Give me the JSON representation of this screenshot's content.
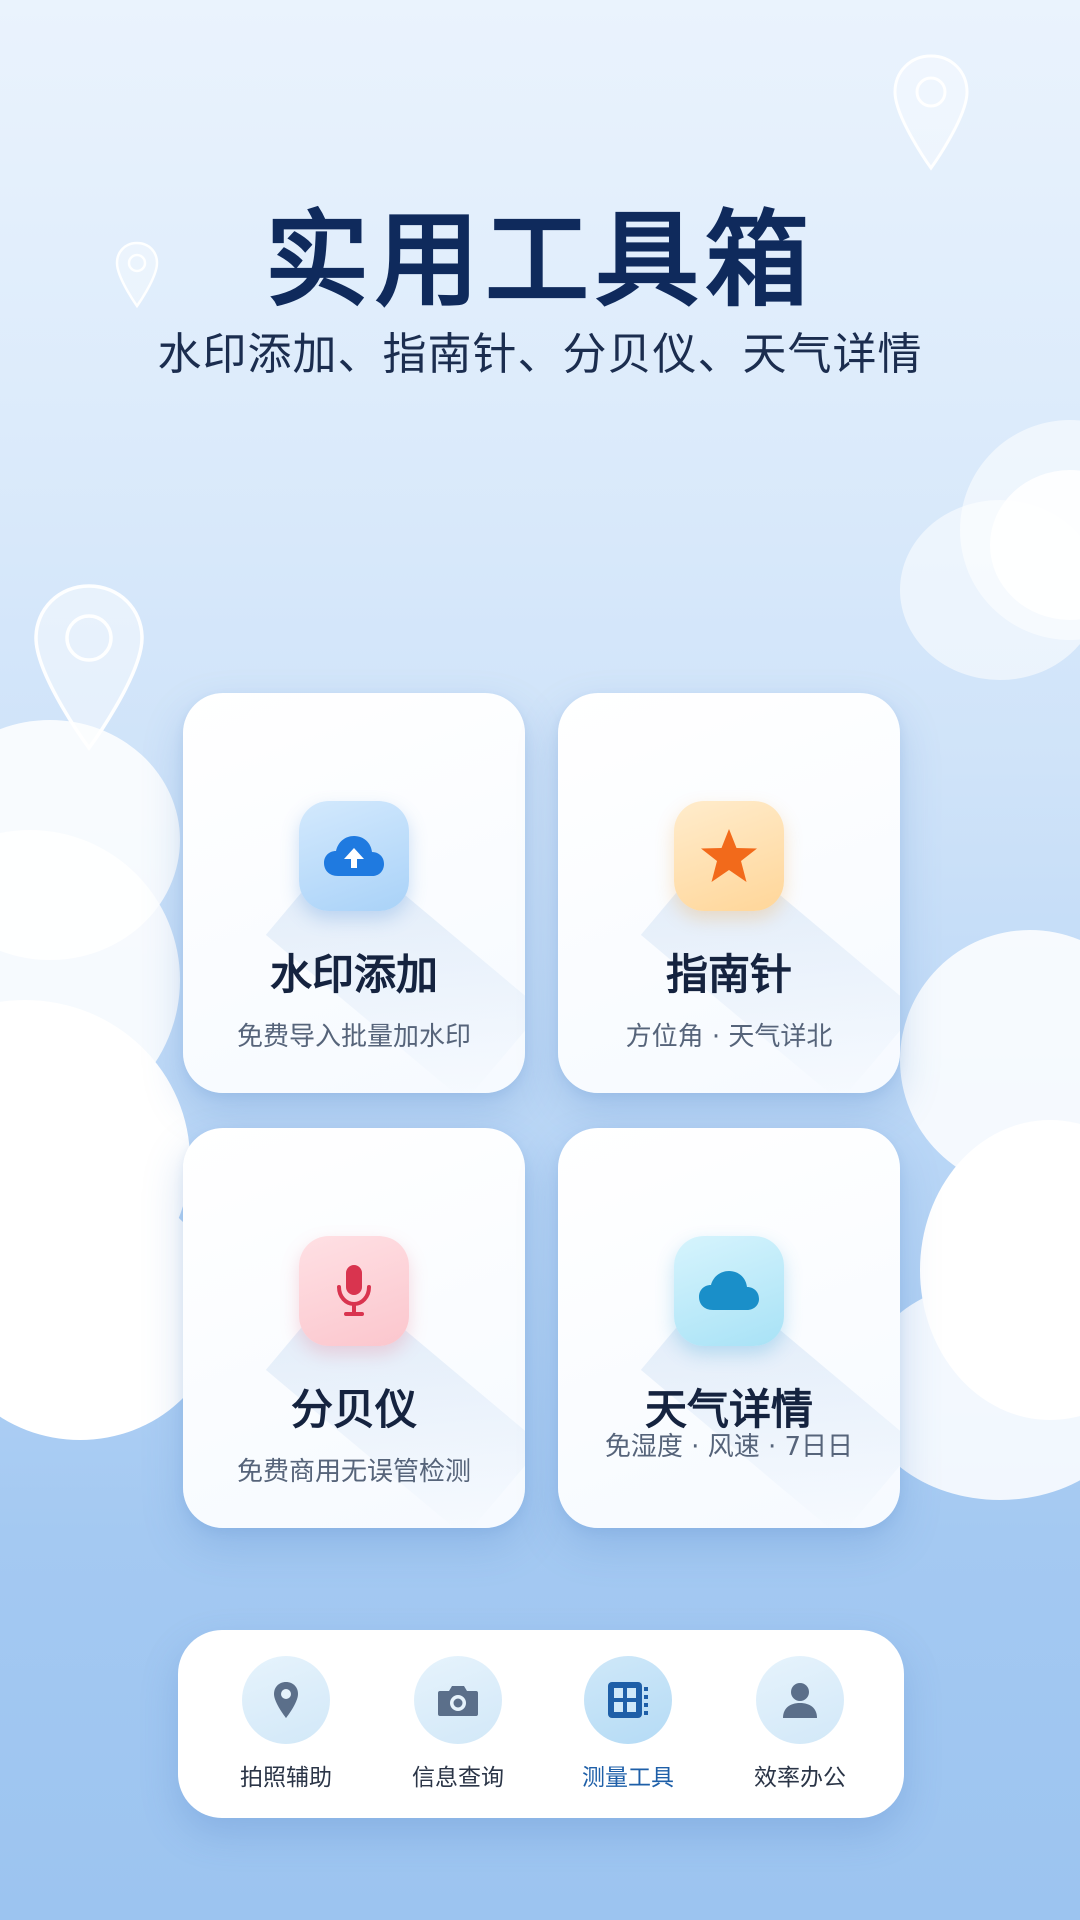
{
  "header": {
    "title": "实用工具箱",
    "subtitle": "水印添加、指南针、分贝仪、天气详情"
  },
  "cards": [
    {
      "title": "水印添加",
      "desc": "免费导入批量加水印",
      "icon": "cloud-upload-icon",
      "accent": "#1f7ae0"
    },
    {
      "title": "指南针",
      "desc": "方位角 · 天气详北",
      "icon": "star-icon",
      "accent": "#f26a1b"
    },
    {
      "title": "分贝仪",
      "desc": "免费商用无误管检测",
      "icon": "microphone-icon",
      "accent": "#d9344f"
    },
    {
      "title": "天气详情",
      "desc": "免湿度 · 风速 · 7日日",
      "icon": "cloud-icon",
      "accent": "#1a8fc9"
    }
  ],
  "bottom_nav": {
    "items": [
      {
        "label": "拍照辅助",
        "icon": "location-pin-icon",
        "active": false
      },
      {
        "label": "信息查询",
        "icon": "camera-icon",
        "active": false
      },
      {
        "label": "测量工具",
        "icon": "grid-tool-icon",
        "active": true
      },
      {
        "label": "效率办公",
        "icon": "person-icon",
        "active": false
      }
    ]
  },
  "colors": {
    "title": "#0f2a5c",
    "active_nav": "#1e5fa8",
    "icon_gray": "#5b6f8a"
  }
}
